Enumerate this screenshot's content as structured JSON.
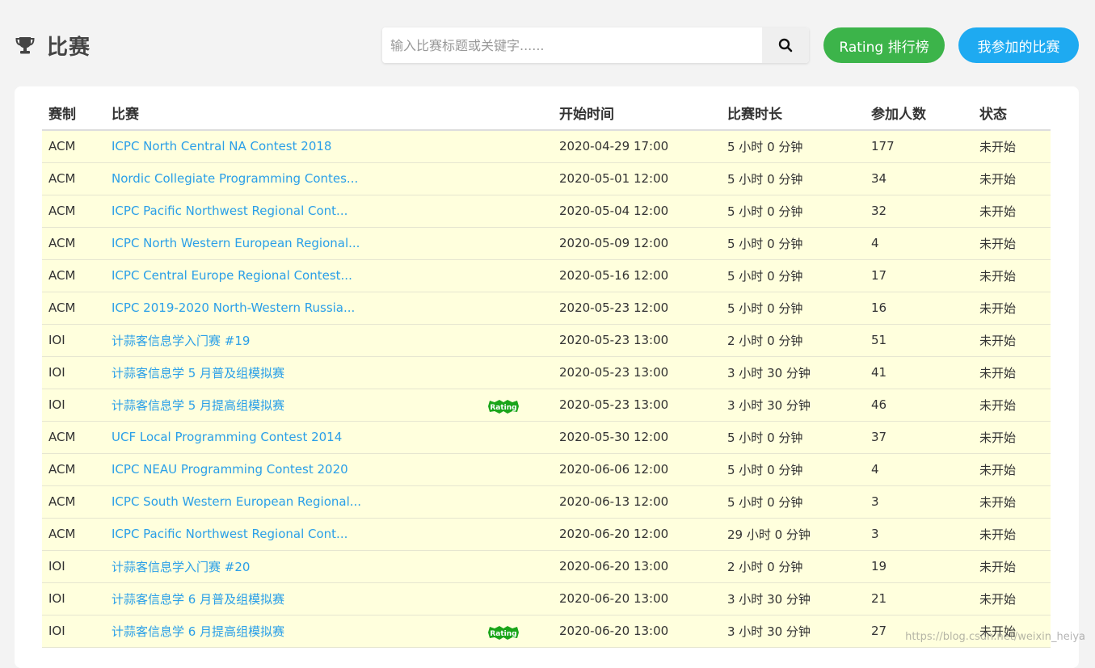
{
  "header": {
    "title": "比赛",
    "search_placeholder": "输入比赛标题或关键字......",
    "rating_button": "Rating 排行榜",
    "mine_button": "我参加的比赛"
  },
  "table": {
    "columns": [
      "赛制",
      "比赛",
      "开始时间",
      "比赛时长",
      "参加人数",
      "状态"
    ],
    "rows": [
      {
        "type": "ACM",
        "name": "ICPC North Central NA Contest 2018",
        "start": "2020-04-29 17:00",
        "duration": "5 小时 0 分钟",
        "count": "177",
        "status": "未开始",
        "rating": false
      },
      {
        "type": "ACM",
        "name": "Nordic Collegiate Programming Contes...",
        "start": "2020-05-01 12:00",
        "duration": "5 小时 0 分钟",
        "count": "34",
        "status": "未开始",
        "rating": false
      },
      {
        "type": "ACM",
        "name": "ICPC Pacific Northwest Regional Cont...",
        "start": "2020-05-04 12:00",
        "duration": "5 小时 0 分钟",
        "count": "32",
        "status": "未开始",
        "rating": false
      },
      {
        "type": "ACM",
        "name": "ICPC North Western European Regional...",
        "start": "2020-05-09 12:00",
        "duration": "5 小时 0 分钟",
        "count": "4",
        "status": "未开始",
        "rating": false
      },
      {
        "type": "ACM",
        "name": "ICPC Central Europe Regional Contest...",
        "start": "2020-05-16 12:00",
        "duration": "5 小时 0 分钟",
        "count": "17",
        "status": "未开始",
        "rating": false
      },
      {
        "type": "ACM",
        "name": "ICPC 2019-2020 North-Western Russia...",
        "start": "2020-05-23 12:00",
        "duration": "5 小时 0 分钟",
        "count": "16",
        "status": "未开始",
        "rating": false
      },
      {
        "type": "IOI",
        "name": "计蒜客信息学入门赛 #19",
        "start": "2020-05-23 13:00",
        "duration": "2 小时 0 分钟",
        "count": "51",
        "status": "未开始",
        "rating": false
      },
      {
        "type": "IOI",
        "name": "计蒜客信息学 5 月普及组模拟赛",
        "start": "2020-05-23 13:00",
        "duration": "3 小时 30 分钟",
        "count": "41",
        "status": "未开始",
        "rating": false
      },
      {
        "type": "IOI",
        "name": "计蒜客信息学 5 月提高组模拟赛",
        "start": "2020-05-23 13:00",
        "duration": "3 小时 30 分钟",
        "count": "46",
        "status": "未开始",
        "rating": true
      },
      {
        "type": "ACM",
        "name": "UCF Local Programming Contest 2014",
        "start": "2020-05-30 12:00",
        "duration": "5 小时 0 分钟",
        "count": "37",
        "status": "未开始",
        "rating": false
      },
      {
        "type": "ACM",
        "name": "ICPC NEAU Programming Contest 2020",
        "start": "2020-06-06 12:00",
        "duration": "5 小时 0 分钟",
        "count": "4",
        "status": "未开始",
        "rating": false
      },
      {
        "type": "ACM",
        "name": "ICPC South Western European Regional...",
        "start": "2020-06-13 12:00",
        "duration": "5 小时 0 分钟",
        "count": "3",
        "status": "未开始",
        "rating": false
      },
      {
        "type": "ACM",
        "name": "ICPC Pacific Northwest Regional Cont...",
        "start": "2020-06-20 12:00",
        "duration": "29 小时 0 分钟",
        "count": "3",
        "status": "未开始",
        "rating": false
      },
      {
        "type": "IOI",
        "name": "计蒜客信息学入门赛 #20",
        "start": "2020-06-20 13:00",
        "duration": "2 小时 0 分钟",
        "count": "19",
        "status": "未开始",
        "rating": false
      },
      {
        "type": "IOI",
        "name": "计蒜客信息学 6 月普及组模拟赛",
        "start": "2020-06-20 13:00",
        "duration": "3 小时 30 分钟",
        "count": "21",
        "status": "未开始",
        "rating": false
      },
      {
        "type": "IOI",
        "name": "计蒜客信息学 6 月提高组模拟赛",
        "start": "2020-06-20 13:00",
        "duration": "3 小时 30 分钟",
        "count": "27",
        "status": "未开始",
        "rating": true
      }
    ]
  },
  "rating_badge_label": "Rating",
  "watermark": "https://blog.csdn.net/weixin_heiya",
  "colors": {
    "rating_green": "#3cb44a",
    "mine_blue": "#1eaaf1",
    "link_blue": "#2a9fe8",
    "row_yellow": "#ffffdd",
    "badge_green": "#1aa51a"
  }
}
